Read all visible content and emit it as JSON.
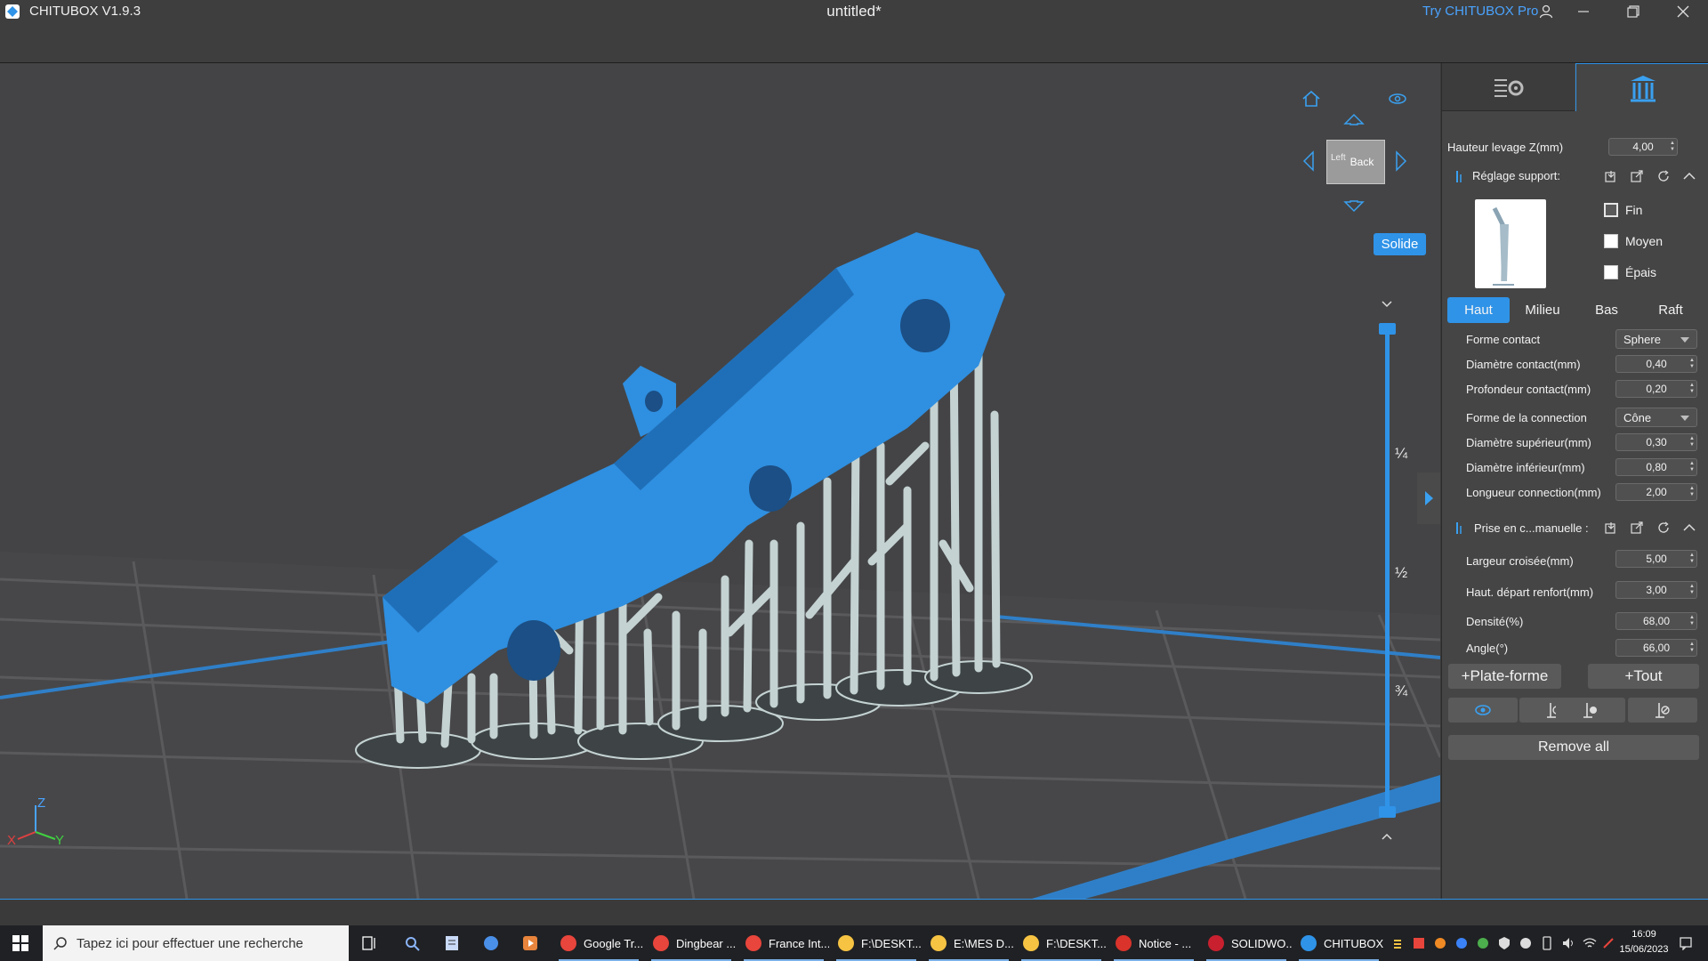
{
  "window": {
    "app_title": "CHITUBOX V1.9.3",
    "document_title": "untitled*",
    "try_pro_label": "Try CHITUBOX Pro"
  },
  "viewport": {
    "view_cube_label": "Back",
    "view_cube_side": "Left",
    "render_mode": "Solide",
    "slider_ticks": [
      "¼",
      "½",
      "¾"
    ],
    "axis_labels": {
      "x": "X",
      "y": "Y",
      "z": "Z"
    }
  },
  "panel": {
    "lift_height_label": "Hauteur levage Z(mm)",
    "lift_height_value": "4,00",
    "support_settings_label": "Réglage support:",
    "density_options": [
      {
        "label": "Fin",
        "checked": true
      },
      {
        "label": "Moyen",
        "checked": false
      },
      {
        "label": "Épais",
        "checked": false
      }
    ],
    "subtabs": [
      "Haut",
      "Milieu",
      "Bas",
      "Raft"
    ],
    "active_subtab": "Haut",
    "contact_shape_label": "Forme contact",
    "contact_shape_value": "Sphere",
    "contact_diameter_label": "Diamètre contact(mm)",
    "contact_diameter_value": "0,40",
    "contact_depth_label": "Profondeur contact(mm)",
    "contact_depth_value": "0,20",
    "connection_shape_label": "Forme de la connection",
    "connection_shape_value": "Cône",
    "upper_diameter_label": "Diamètre supérieur(mm)",
    "upper_diameter_value": "0,30",
    "lower_diameter_label": "Diamètre inférieur(mm)",
    "lower_diameter_value": "0,80",
    "connection_length_label": "Longueur connection(mm)",
    "connection_length_value": "2,00",
    "manual_section_label": "Prise en c...manuelle :",
    "cross_width_label": "Largeur croisée(mm)",
    "cross_width_value": "5,00",
    "reinforce_start_label": "Haut. départ renfort(mm)",
    "reinforce_start_value": "3,00",
    "density_label": "Densité(%)",
    "density_value": "68,00",
    "angle_label": "Angle(°)",
    "angle_value": "66,00",
    "platform_button": "+Plate-forme",
    "all_button": "+Tout",
    "remove_all_button": "Remove all"
  },
  "taskbar": {
    "search_placeholder": "Tapez ici pour effectuer une recherche",
    "apps": [
      {
        "label": "Google Tr...",
        "color": "#e8453c"
      },
      {
        "label": "Dingbear ...",
        "color": "#e8453c"
      },
      {
        "label": "France Int...",
        "color": "#e8453c"
      },
      {
        "label": "F:\\DESKT...",
        "color": "#f6c343"
      },
      {
        "label": "E:\\MES D...",
        "color": "#f6c343"
      },
      {
        "label": "F:\\DESKT...",
        "color": "#f6c343"
      },
      {
        "label": "Notice - ...",
        "color": "#d9332b"
      },
      {
        "label": "SOLIDWO...",
        "color": "#c8202f"
      },
      {
        "label": "CHITUBOX",
        "color": "#2f93e8"
      }
    ],
    "time": "16:09",
    "date": "15/06/2023"
  },
  "colors": {
    "accent": "#2f93e8",
    "model": "#2f8fe0",
    "supports": "#c4d2d2",
    "background": "#444446"
  },
  "icons": [
    "home-icon",
    "eye-icon",
    "arrow-up-icon",
    "arrow-down-icon",
    "arrow-left-icon",
    "arrow-right-icon",
    "user-icon",
    "minimize-icon",
    "maximize-icon",
    "close-icon",
    "windows-start-icon",
    "search-icon",
    "task-view-icon"
  ]
}
